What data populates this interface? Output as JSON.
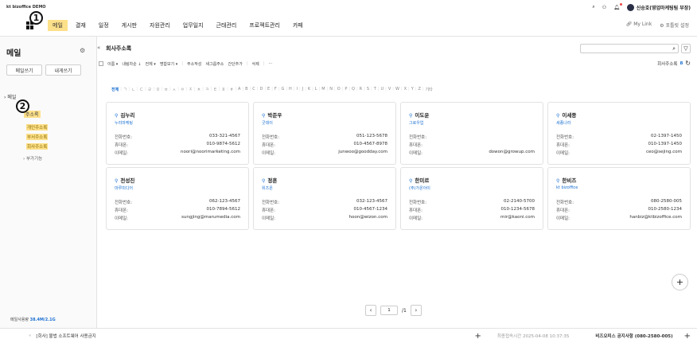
{
  "topbar": {
    "logo": "kt bizoffice DEMO",
    "user_name": "신승호(영업마케팅팀 부장)"
  },
  "nav": {
    "items": [
      "메일",
      "결재",
      "일정",
      "게시판",
      "자원관리",
      "업무일지",
      "근태관리",
      "프로젝트관리",
      "카페"
    ],
    "active": "메일",
    "mylink": "My Link",
    "settings": "포틀릿 설정"
  },
  "sidebar": {
    "title": "메일",
    "compose": "메일쓰기",
    "write_to_me": "내게쓰기",
    "mail_section": "메일",
    "addressbook": "주소록",
    "sub_items": [
      "개인주소록",
      "부서주소록",
      "회사주소록"
    ],
    "extra": "부가기능",
    "quota_label": "메일사용량",
    "quota_value": "38.4M/2.1G"
  },
  "main": {
    "title": "회사주소록",
    "count_label": "회사주소록",
    "count": "8",
    "toolbar": [
      "이름 ▾",
      "내림차순 ↓",
      "전체 ▾",
      "명함보기 ▾",
      "주소작성",
      "새그룹주소",
      "간단추가",
      "삭제",
      "···"
    ],
    "alpha": [
      "전체",
      "ㄱ",
      "ㄴ",
      "ㄷ",
      "ㄹ",
      "ㅁ",
      "ㅂ",
      "ㅅ",
      "ㅇ",
      "ㅈ",
      "ㅊ",
      "ㅋ",
      "ㅌ",
      "ㅍ",
      "ㅎ",
      "A",
      "B",
      "C",
      "D",
      "E",
      "F",
      "G",
      "H",
      "I",
      "J",
      "K",
      "L",
      "M",
      "N",
      "O",
      "P",
      "Q",
      "R",
      "S",
      "T",
      "U",
      "V",
      "W",
      "X",
      "Y",
      "Z",
      "기타"
    ],
    "field_labels": {
      "phone": "전화번호:",
      "mobile": "휴대폰:",
      "email": "이메일:"
    },
    "cards": [
      {
        "name": "김누리",
        "company": "누리마케팅",
        "phone": "033-321-4567",
        "mobile": "010-9874-5612",
        "email": "noori@noorimarketing.com"
      },
      {
        "name": "박준우",
        "company": "굿데이",
        "phone": "051-123-5678",
        "mobile": "010-4567-8978",
        "email": "junwoo@goodday.com"
      },
      {
        "name": "이도운",
        "company": "그로우업",
        "phone": "",
        "mobile": "",
        "email": "dowon@growup.com"
      },
      {
        "name": "이세종",
        "company": "세종나라",
        "phone": "02-1397-1450",
        "mobile": "010-1397-1450",
        "email": "ceo@sejing.com"
      },
      {
        "name": "전성진",
        "company": "마루미디어",
        "phone": "062-123-4567",
        "mobile": "010-7894-5612",
        "email": "sungjing@marumedia.com"
      },
      {
        "name": "정훈",
        "company": "위즈온",
        "phone": "032-123-4567",
        "mobile": "010-4567-1234",
        "email": "hoon@wizon.com"
      },
      {
        "name": "한미르",
        "company": "(주)가온아이",
        "phone": "02-2140-5700",
        "mobile": "010-1234-5678",
        "email": "mir@kaoni.com"
      },
      {
        "name": "한비즈",
        "company": "kt bizoffice",
        "phone": "080-2580-005",
        "mobile": "010-2580-1234",
        "email": "hanbiz@ktbizoffice.com"
      }
    ],
    "pager": {
      "current": "1",
      "total": "/1"
    }
  },
  "footer": {
    "notice_left": "[회사] 불법 소프트웨어 사용금지",
    "last_login": "최종접속시간 2025-04-08 10:37:35",
    "notice_right": "비즈오피스 공지사항 (080-2580-005)"
  },
  "badges": [
    "1",
    "2"
  ],
  "colors": {
    "highlight": "#fde08a",
    "accent": "#1a6fd1"
  }
}
